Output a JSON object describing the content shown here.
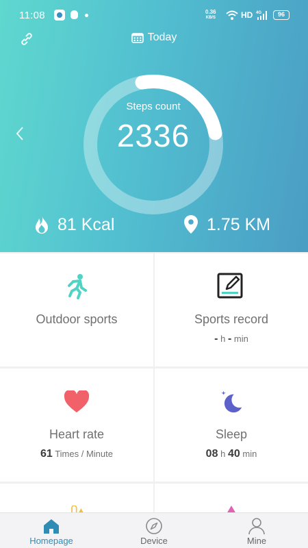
{
  "status_bar": {
    "time": "11:08",
    "speed_value": "0.36",
    "speed_unit": "KB/S",
    "hd": "HD",
    "network": "4G",
    "battery": "96"
  },
  "header": {
    "date_label": "Today"
  },
  "steps": {
    "label": "Steps count",
    "value": "2336",
    "progress": 0.25
  },
  "metrics": {
    "kcal": "81 Kcal",
    "distance": "1.75 KM"
  },
  "tiles": {
    "outdoor": {
      "title": "Outdoor sports"
    },
    "record": {
      "title": "Sports record",
      "hours": "-",
      "hours_unit": "h",
      "minutes": "-",
      "minutes_unit": "min"
    },
    "heart": {
      "title": "Heart rate",
      "value": "61",
      "unit": "Times / Minute"
    },
    "sleep": {
      "title": "Sleep",
      "hours": "08",
      "hours_unit": "h",
      "minutes": "40",
      "minutes_unit": "min"
    }
  },
  "nav": {
    "home": "Homepage",
    "device": "Device",
    "mine": "Mine"
  },
  "colors": {
    "accent": "#2e8cb5",
    "heart": "#f0616a",
    "sleep": "#5c62c9",
    "runner": "#4fd3c4"
  }
}
